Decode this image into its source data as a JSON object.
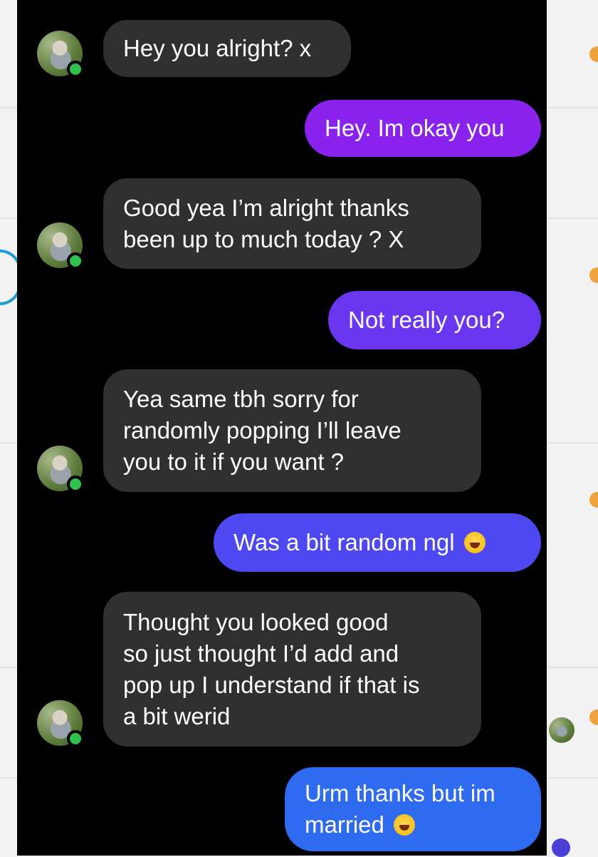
{
  "colors": {
    "background": "#000000",
    "incoming_bubble": "#303030",
    "outgoing_gradient": [
      "#8a2be2",
      "#6a3cf0",
      "#4d4df2",
      "#3a5cf0",
      "#2f6ef0"
    ],
    "online_dot": "#31c24d"
  },
  "messages": [
    {
      "direction": "incoming",
      "lines": [
        "Hey you alright? x"
      ],
      "show_avatar": true
    },
    {
      "direction": "outgoing",
      "lines": [
        "Hey. Im okay you"
      ]
    },
    {
      "direction": "incoming",
      "lines": [
        "Good yea I’m alright thanks",
        "been up to much today ? X"
      ],
      "show_avatar": true
    },
    {
      "direction": "outgoing",
      "lines": [
        "Not really you?"
      ]
    },
    {
      "direction": "incoming",
      "lines": [
        "Yea same tbh sorry for",
        "randomly popping I’ll leave",
        "you to it if you want ?"
      ],
      "show_avatar": true
    },
    {
      "direction": "outgoing",
      "lines": [
        "Was a bit random ngl"
      ],
      "emoji": "rolling-on-floor-laughing-emoji"
    },
    {
      "direction": "incoming",
      "lines": [
        "Thought you looked good",
        "so just thought I’d add and",
        "pop up I understand if that is",
        "a bit werid"
      ],
      "show_avatar": true
    },
    {
      "direction": "outgoing",
      "lines": [
        "Urm thanks but im",
        "married"
      ],
      "emoji": "rolling-on-floor-laughing-emoji"
    }
  ]
}
